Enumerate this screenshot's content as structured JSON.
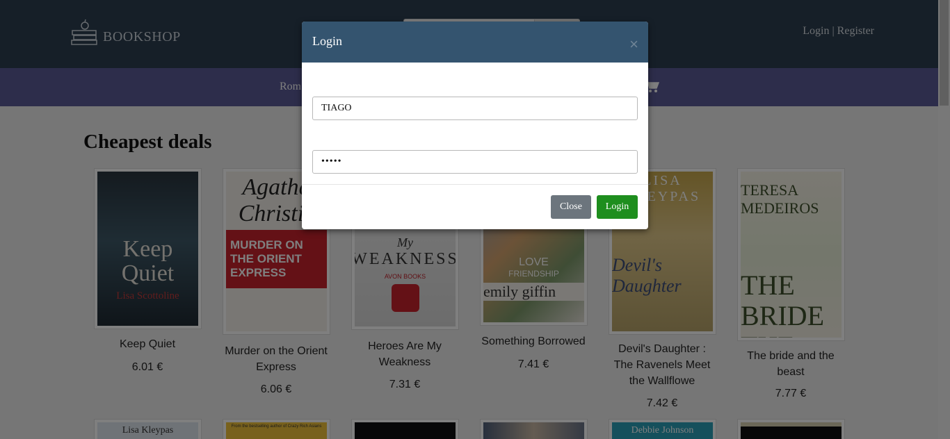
{
  "header": {
    "logo_text": "BOOKSHOP",
    "login_link": "Login",
    "separator": "|",
    "register_link": "Register"
  },
  "nav": {
    "items": [
      "Rom"
    ]
  },
  "main": {
    "section_title": "Cheapest deals",
    "books": [
      {
        "title_lines": [
          "Keep Quiet"
        ],
        "price": "6.01 €",
        "cover": {
          "line1": "Keep",
          "line2": "Quiet",
          "author": "Lisa Scottoline"
        }
      },
      {
        "title_lines": [
          "Murder on the Orient",
          "Express"
        ],
        "price": "6.06 €",
        "cover": {
          "line1": "Agatha",
          "line2": "Christie",
          "author": "MURDER ON THE ORIENT EXPRESS"
        }
      },
      {
        "title_lines": [
          "Heroes Are My",
          "Weakness"
        ],
        "price": "7.31 €",
        "cover": {
          "line1": "My",
          "line2": "WEAKNESS",
          "author": "AVON BOOKS"
        }
      },
      {
        "title_lines": [
          "Something Borrowed"
        ],
        "price": "7.41 €",
        "cover": {
          "line1": "LOVE",
          "line2": "FRIENDSHIP",
          "author": "emily giffin"
        }
      },
      {
        "title_lines": [
          "Devil's Daughter :",
          "The Ravenels Meet",
          "the Wallflowe"
        ],
        "price": "7.42 €",
        "cover": {
          "line1": "LISA",
          "line2": "KLEYPAS",
          "author": "Devil's Daughter"
        }
      },
      {
        "title_lines": [
          "The bride and the",
          "beast"
        ],
        "price": "7.77 €",
        "cover": {
          "line1": "TERESA MEDEIROS",
          "line2": "THE BRIDE",
          "author": "THE BEAST"
        }
      }
    ],
    "row2_covers": [
      "Lisa Kleypas",
      "From the bestselling author of Crazy Rich Asians",
      "",
      "",
      "Debbie Johnson",
      ""
    ]
  },
  "modal": {
    "title": "Login",
    "close_x": "×",
    "username_value": "TIAGO",
    "password_value": "•••••",
    "close_button": "Close",
    "login_button": "Login"
  },
  "colors": {
    "header_bg": "#2c3e50",
    "nav_bg": "#5a5a96",
    "modal_header_bg": "#34546f",
    "login_button_bg": "#1e8e1e",
    "close_button_bg": "#6c757d"
  }
}
